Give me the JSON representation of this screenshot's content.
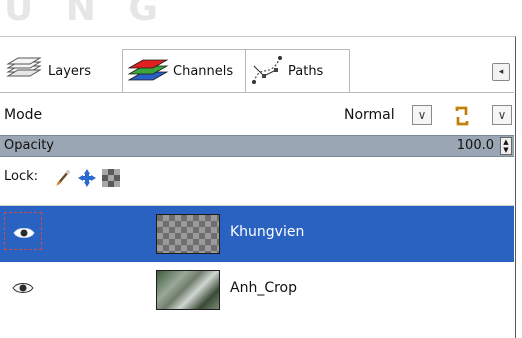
{
  "watermark": "U N G",
  "tabs": [
    {
      "label": "Layers",
      "icon": "layers-icon"
    },
    {
      "label": "Channels",
      "icon": "channels-icon"
    },
    {
      "label": "Paths",
      "icon": "paths-icon"
    }
  ],
  "mode": {
    "label": "Mode",
    "value": "Normal"
  },
  "opacity": {
    "label": "Opacity",
    "value": "100.0"
  },
  "lock": {
    "label": "Lock:",
    "icons": [
      "paintbrush-lock-icon",
      "position-lock-icon",
      "alpha-lock-icon"
    ]
  },
  "layers": [
    {
      "name": "Khungvien",
      "selected": true,
      "visible": true,
      "thumbnail": "transparent-checker"
    },
    {
      "name": "Anh_Crop",
      "selected": false,
      "visible": true,
      "thumbnail": "photo"
    }
  ],
  "colors": {
    "selection": "#2a62c2",
    "opacity_bar": "#9aa6b3",
    "panel_border": "#5a5a5a"
  }
}
